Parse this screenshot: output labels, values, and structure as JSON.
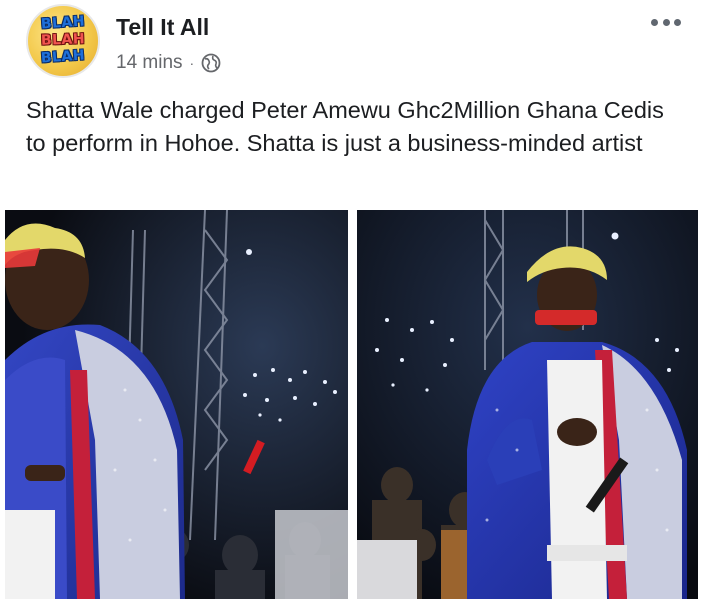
{
  "post": {
    "page_name": "Tell It All",
    "time": "14 mins",
    "separator": "·",
    "privacy_icon": "globe-icon",
    "more_icon": "more-options-icon",
    "avatar_text": [
      "BLAH",
      "BLAH",
      "BLAH"
    ],
    "caption": "Shatta Wale charged Peter Amewu Ghc2Million Ghana Cedis to perform in Hohoe.  Shatta is just a business-minded artist"
  },
  "photos": {
    "count": 2
  },
  "colors": {
    "text": "#1c1e21",
    "meta": "#65676b",
    "jacket_blue": "#2a3fb8",
    "jacket_red": "#c4203a",
    "jacket_silver": "#c9cde0",
    "hair_blonde": "#e3d86a",
    "stage_dark": "#0b0d14"
  }
}
